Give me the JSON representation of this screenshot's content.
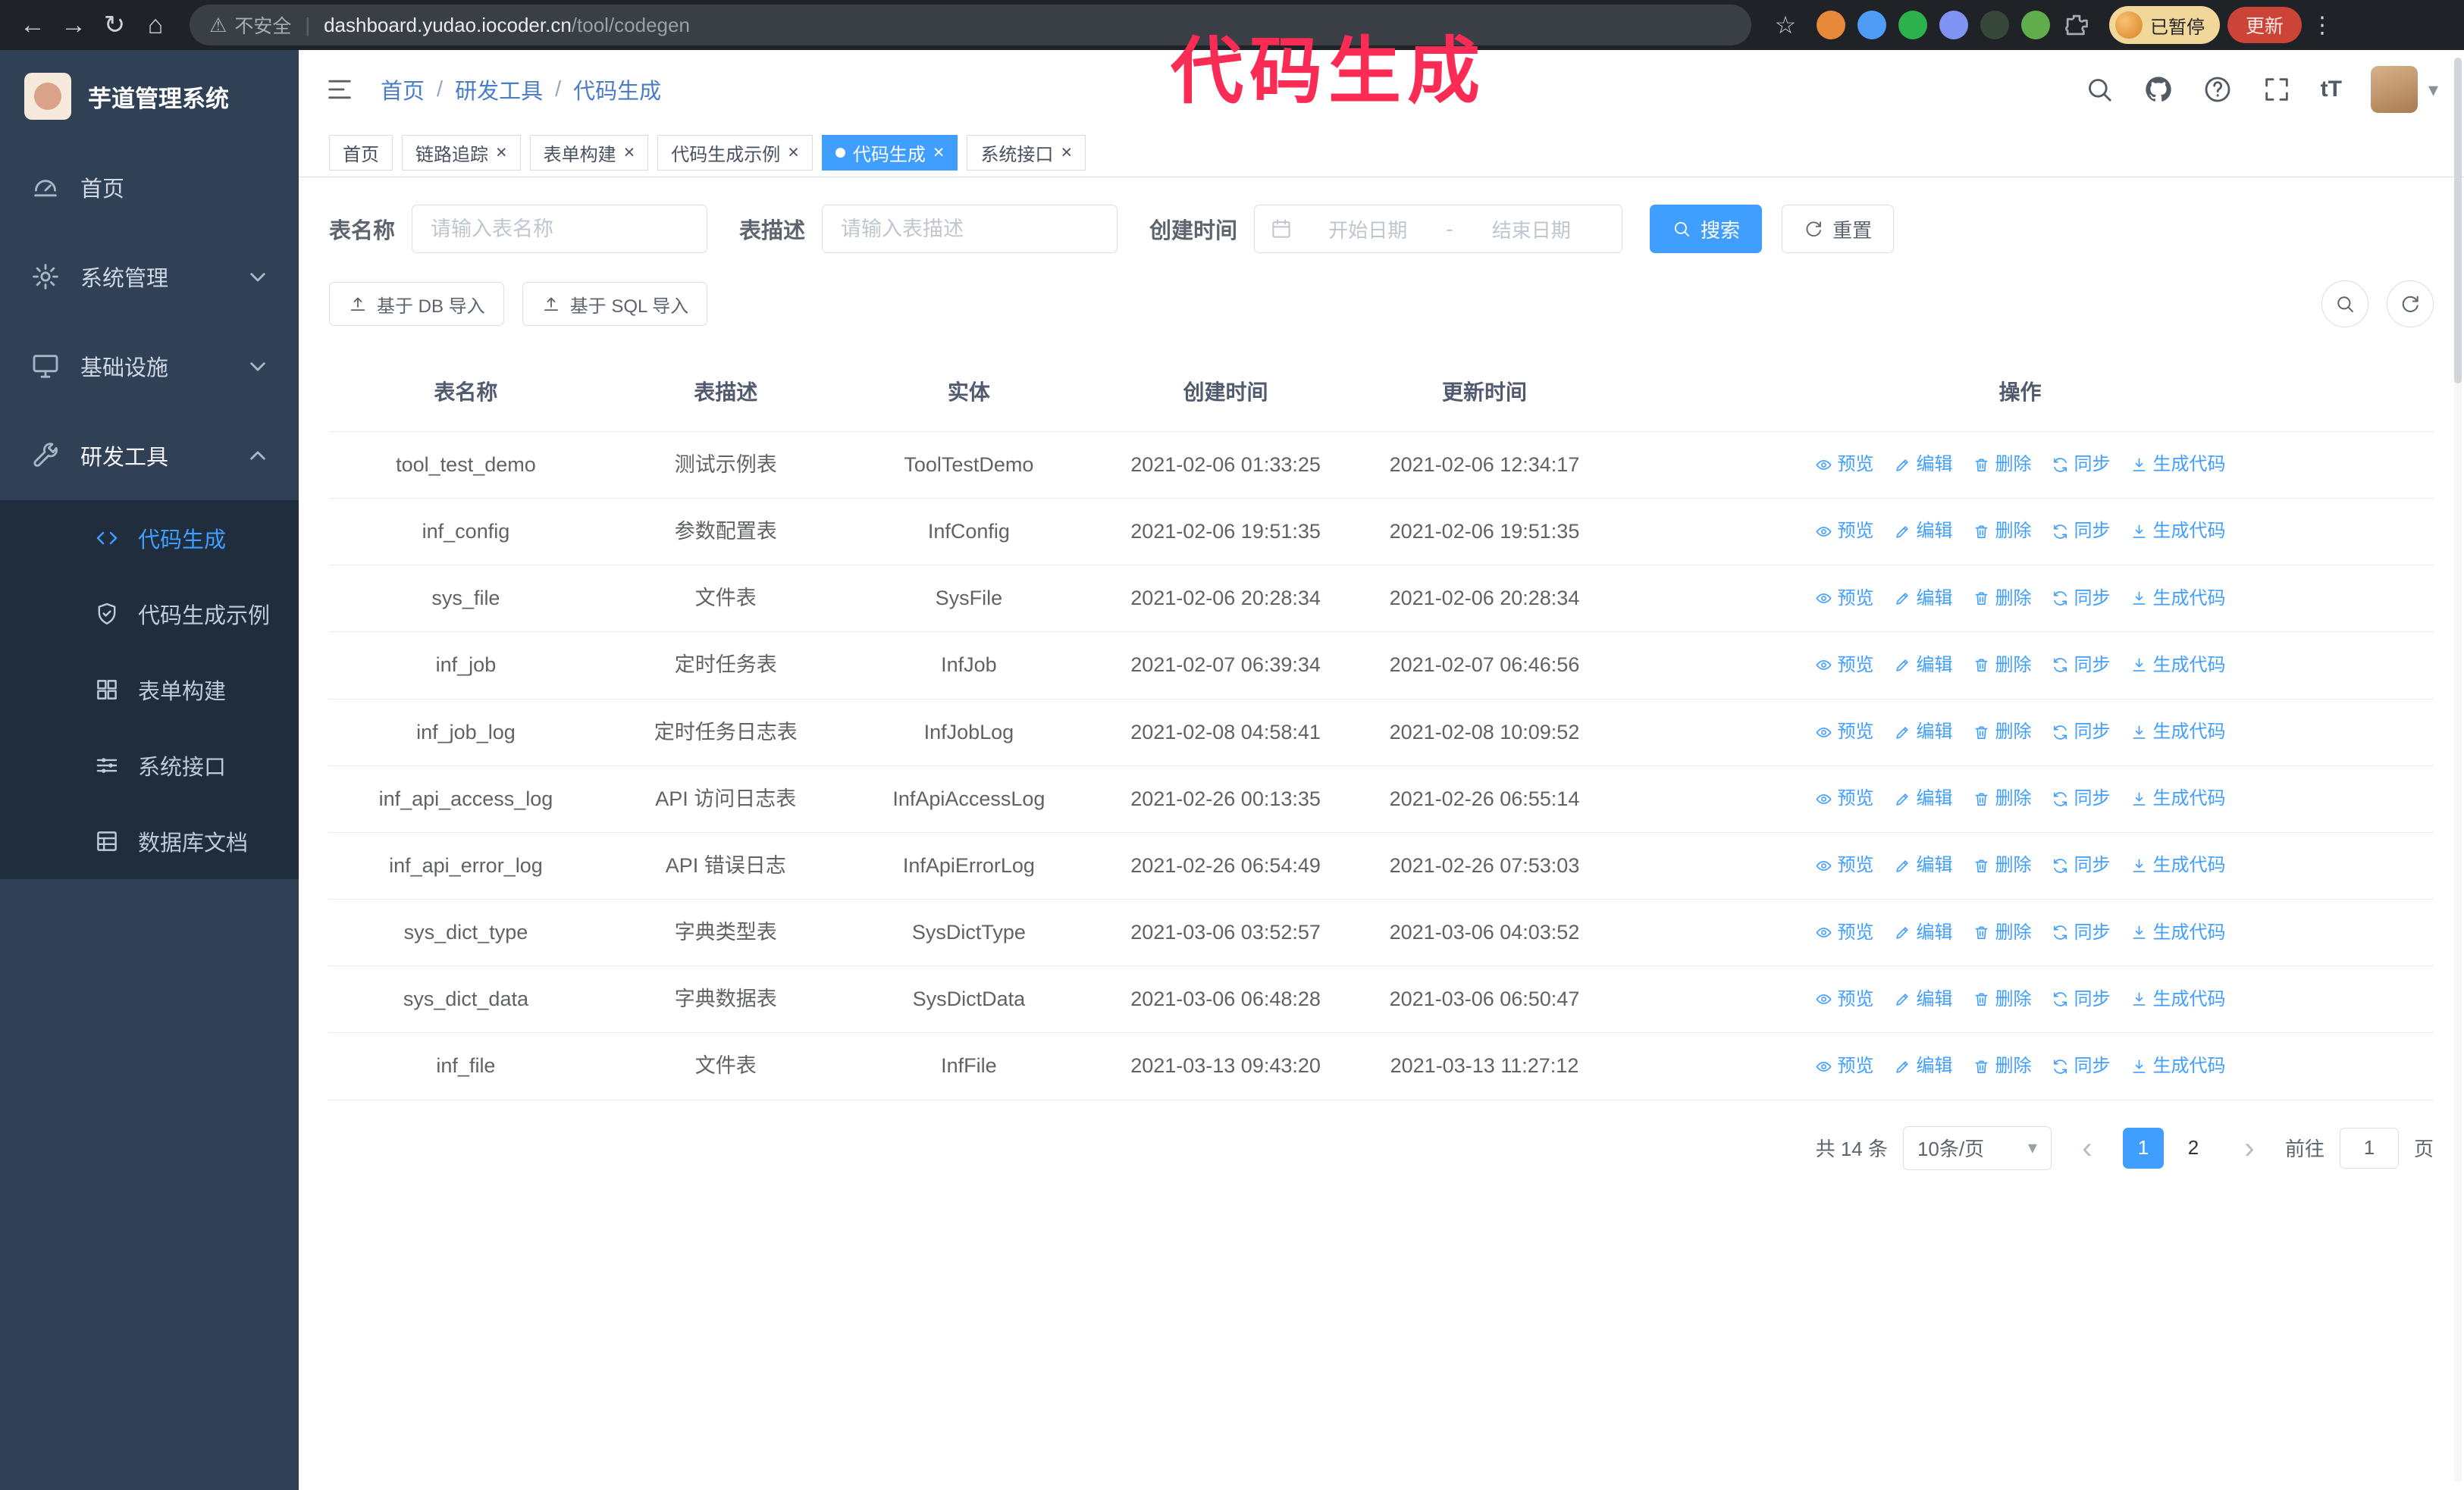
{
  "annotation": {
    "text": "代码生成",
    "color": "#fa2c55"
  },
  "icons": {
    "back": "←",
    "forward": "→",
    "reload": "↻",
    "home": "⌂",
    "warning": "⚠",
    "divider": "|",
    "star": "☆",
    "more": "⋮",
    "caret": "▾",
    "prev": "‹",
    "next": "›"
  },
  "browser": {
    "insecure_label": "不安全",
    "url_host": "dashboard.yudao.iocoder.cn",
    "url_path": "/tool/codegen",
    "paused_badge": "已暂停",
    "update_button": "更新",
    "extension_icons": [
      {
        "name": "fox-ext-icon",
        "color": "#e8883b"
      },
      {
        "name": "drop-ext-icon",
        "color": "#4f9cf7"
      },
      {
        "name": "check-ext-icon",
        "color": "#2bb24c"
      },
      {
        "name": "people-ext-icon",
        "color": "#7f93f2"
      },
      {
        "name": "terminal-ext-icon",
        "color": "#37483a"
      },
      {
        "name": "leaf-ext-icon",
        "color": "#5fae4b"
      },
      {
        "name": "puzzle-icon",
        "color": "#a6abb3"
      }
    ]
  },
  "sidebar": {
    "logo_title": "芋道管理系统",
    "items": [
      {
        "id": "home",
        "label": "首页",
        "icon": "gauge-icon"
      },
      {
        "id": "system",
        "label": "系统管理",
        "icon": "gear-icon",
        "chevron": "down"
      },
      {
        "id": "infra",
        "label": "基础设施",
        "icon": "infra-icon",
        "chevron": "down"
      },
      {
        "id": "devtools",
        "label": "研发工具",
        "icon": "tools-icon",
        "chevron": "up",
        "expanded": true
      }
    ],
    "submenu": [
      {
        "id": "codegen",
        "label": "代码生成",
        "icon": "code-icon",
        "active": true
      },
      {
        "id": "codegen-example",
        "label": "代码生成示例",
        "icon": "shield-icon"
      },
      {
        "id": "form-builder",
        "label": "表单构建",
        "icon": "form-icon"
      },
      {
        "id": "api",
        "label": "系统接口",
        "icon": "api-icon"
      },
      {
        "id": "db-doc",
        "label": "数据库文档",
        "icon": "db-doc-icon"
      }
    ]
  },
  "header": {
    "breadcrumb": [
      "首页",
      "研发工具",
      "代码生成"
    ],
    "right_icons": [
      "search-icon",
      "github-icon",
      "question-icon",
      "fullscreen-icon",
      "font-size-icon"
    ]
  },
  "tabs": [
    {
      "id": "home",
      "label": "首页",
      "closable": false
    },
    {
      "id": "tracing",
      "label": "链路追踪",
      "closable": true
    },
    {
      "id": "form-builder",
      "label": "表单构建",
      "closable": true
    },
    {
      "id": "codegen-example",
      "label": "代码生成示例",
      "closable": true
    },
    {
      "id": "codegen",
      "label": "代码生成",
      "closable": true,
      "active": true
    },
    {
      "id": "api",
      "label": "系统接口",
      "closable": true
    }
  ],
  "filters": {
    "table_name_label": "表名称",
    "table_name_placeholder": "请输入表名称",
    "table_desc_label": "表描述",
    "table_desc_placeholder": "请输入表描述",
    "create_time_label": "创建时间",
    "date_start_placeholder": "开始日期",
    "date_separator": "-",
    "date_end_placeholder": "结束日期",
    "search_button": "搜索",
    "reset_button": "重置"
  },
  "toolbar": {
    "import_db": "基于 DB 导入",
    "import_sql": "基于 SQL 导入"
  },
  "table": {
    "columns": [
      "表名称",
      "表描述",
      "实体",
      "创建时间",
      "更新时间",
      "操作"
    ],
    "actions": [
      {
        "id": "preview",
        "label": "预览",
        "icon": "eye-icon"
      },
      {
        "id": "edit",
        "label": "编辑",
        "icon": "edit-icon"
      },
      {
        "id": "delete",
        "label": "删除",
        "icon": "delete-icon"
      },
      {
        "id": "sync",
        "label": "同步",
        "icon": "sync-icon"
      },
      {
        "id": "generate",
        "label": "生成代码",
        "icon": "download-icon"
      }
    ],
    "rows": [
      {
        "name": "tool_test_demo",
        "desc": "测试示例表",
        "entity": "ToolTestDemo",
        "created": "2021-02-06 01:33:25",
        "updated": "2021-02-06 12:34:17"
      },
      {
        "name": "inf_config",
        "desc": "参数配置表",
        "entity": "InfConfig",
        "created": "2021-02-06 19:51:35",
        "updated": "2021-02-06 19:51:35"
      },
      {
        "name": "sys_file",
        "desc": "文件表",
        "entity": "SysFile",
        "created": "2021-02-06 20:28:34",
        "updated": "2021-02-06 20:28:34"
      },
      {
        "name": "inf_job",
        "desc": "定时任务表",
        "entity": "InfJob",
        "created": "2021-02-07 06:39:34",
        "updated": "2021-02-07 06:46:56"
      },
      {
        "name": "inf_job_log",
        "desc": "定时任务日志表",
        "entity": "InfJobLog",
        "created": "2021-02-08 04:58:41",
        "updated": "2021-02-08 10:09:52"
      },
      {
        "name": "inf_api_access_log",
        "desc": "API 访问日志表",
        "entity": "InfApiAccessLog",
        "created": "2021-02-26 00:13:35",
        "updated": "2021-02-26 06:55:14"
      },
      {
        "name": "inf_api_error_log",
        "desc": "API 错误日志",
        "entity": "InfApiErrorLog",
        "created": "2021-02-26 06:54:49",
        "updated": "2021-02-26 07:53:03"
      },
      {
        "name": "sys_dict_type",
        "desc": "字典类型表",
        "entity": "SysDictType",
        "created": "2021-03-06 03:52:57",
        "updated": "2021-03-06 04:03:52"
      },
      {
        "name": "sys_dict_data",
        "desc": "字典数据表",
        "entity": "SysDictData",
        "created": "2021-03-06 06:48:28",
        "updated": "2021-03-06 06:50:47"
      },
      {
        "name": "inf_file",
        "desc": "文件表",
        "entity": "InfFile",
        "created": "2021-03-13 09:43:20",
        "updated": "2021-03-13 11:27:12"
      }
    ]
  },
  "pagination": {
    "total": "共 14 条",
    "page_size": "10条/页",
    "pages": [
      "1",
      "2"
    ],
    "active_page": "1",
    "goto_label": "前往",
    "goto_value": "1",
    "goto_suffix": "页"
  }
}
